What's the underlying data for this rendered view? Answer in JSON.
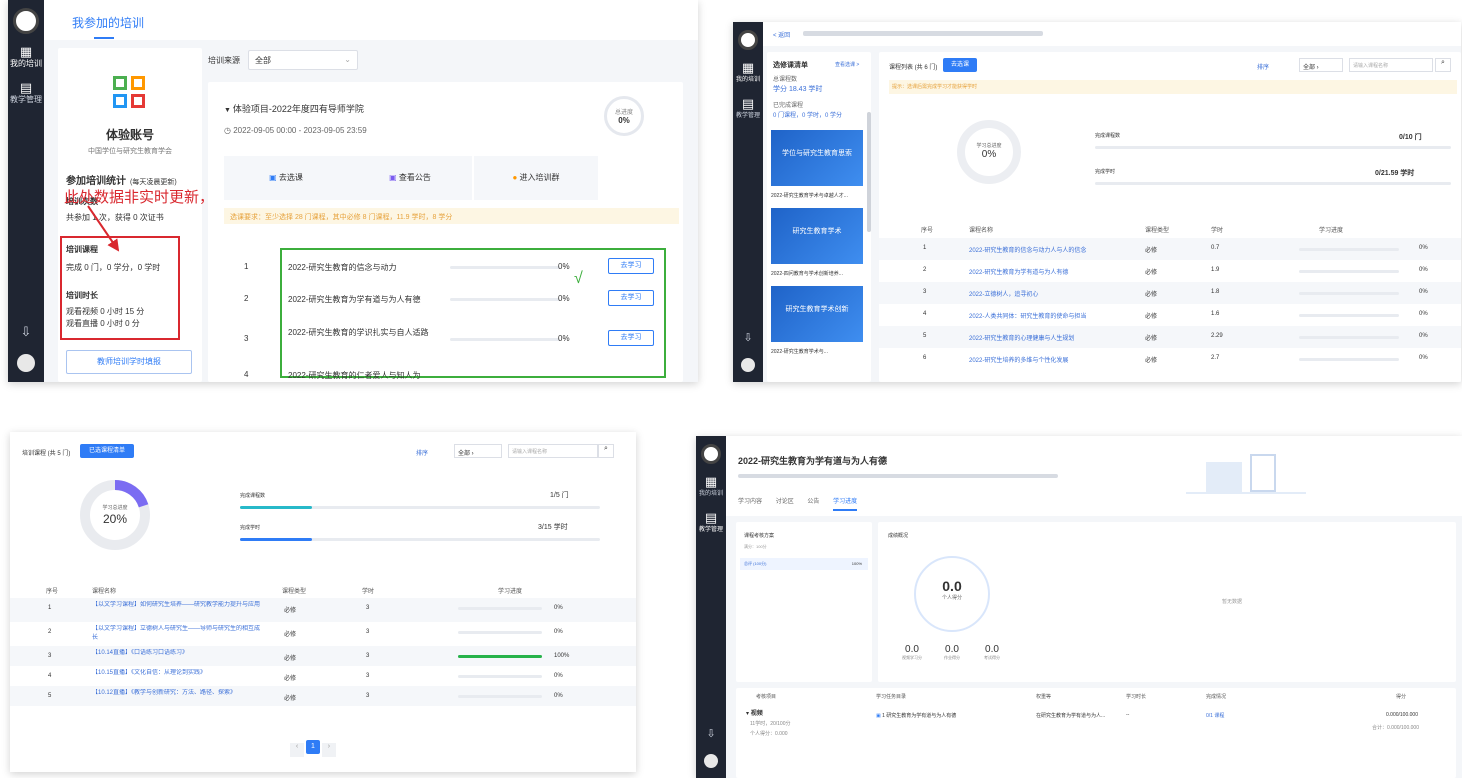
{
  "p1": {
    "nav": [
      {
        "icon": "training-icon",
        "label": "我的培训"
      },
      {
        "icon": "manage-icon",
        "label": "教学管理"
      }
    ],
    "tab": "我参加的培训",
    "account_name": "体验账号",
    "org": "中国学位与研究生教育学会",
    "stats_title": "参加培训统计",
    "stats_note": "(每天凌晨更新)",
    "stats_sub": "培训次数",
    "stats_line": "共参加 1 次，获得 0 次证书",
    "course_title": "培训课程",
    "course_line": "完成 0 门，0 学分，0 学时",
    "time_title": "培训时长",
    "time_line1": "观看视频 0 小时 15 分",
    "time_line2": "观看直播 0 小时 0 分",
    "apply_btn": "教师培训学时填报",
    "filter_label": "培训来源",
    "filter_value": "全部",
    "project_title": "体验项目-2022年度四有导师学院",
    "date_range": "2022-09-05 00:00 - 2023-09-05 23:59",
    "ring_label": "总进度",
    "ring_value": "0%",
    "actions": [
      "去选课",
      "查看公告",
      "进入培训群"
    ],
    "notice": "选课要求：至少选择 28 门课程，其中必修 8 门课程，11.9 学时，8 学分",
    "annotation": "此处数据非实时更新，请以右侧数据为准",
    "check": "√",
    "courses": [
      {
        "no": "1",
        "name": "2022-研究生教育的信念与动力",
        "pct": "0%",
        "btn": "去学习"
      },
      {
        "no": "2",
        "name": "2022-研究生教育为学有道与为人有德",
        "pct": "0%",
        "btn": "去学习"
      },
      {
        "no": "3",
        "name": "2022-研究生教育的学识扎实与自人适路",
        "pct": "0%",
        "btn": "去学习"
      },
      {
        "no": "4",
        "name": "2022-研究生教育的仁者爱人与知人为",
        "pct": "",
        "btn": ""
      }
    ]
  },
  "p2": {
    "nav": [
      {
        "icon": "training-icon",
        "label": "我的培训"
      },
      {
        "icon": "manage-icon",
        "label": "教学管理"
      }
    ],
    "back": "< 返回",
    "left_title": "选修课清单",
    "left_link": "查看选课 >",
    "left_total_label": "总课程数",
    "left_total": "学分 18.43 学时",
    "left_done_label": "已完成课程",
    "left_done": "0 门课程，0 学时，0 学分",
    "videos": [
      "2022-研究生教育学术与卓越人才...",
      "2022-四问教育与学术创新培养...",
      "2022-研究生教育学术与..."
    ],
    "thumb_texts": [
      "学位与研究生教育思索",
      "研究生教育学术",
      "研究生教育学术创新"
    ],
    "tab_label": "课程列表 (共 6 门)",
    "tab_btn": "去选课",
    "notice": "提示：选课后需完成学习才能获得学时",
    "sort": "排序",
    "filter": "全部",
    "search_placeholder": "请输入课程名称",
    "ring_label": "学习总进度",
    "ring_value": "0%",
    "m1_label": "完成课程数",
    "m1_value": "0/10 门",
    "m2_label": "完成学时",
    "m2_value": "0/21.59 学时",
    "headers": [
      "序号",
      "课程名称",
      "课程类型",
      "学时",
      "学习进度"
    ],
    "rows": [
      {
        "no": "1",
        "name": "2022-研究生教育的信念与动力人与人的信念",
        "type": "必修",
        "hours": "0.7",
        "pct": "0%"
      },
      {
        "no": "2",
        "name": "2022-研究生教育为学有道与为人有德",
        "type": "必修",
        "hours": "1.9",
        "pct": "0%"
      },
      {
        "no": "3",
        "name": "2022-立德树人，追寻初心",
        "type": "必修",
        "hours": "1.8",
        "pct": "0%"
      },
      {
        "no": "4",
        "name": "2022-人类共同体：研究生教育的使命与担当",
        "type": "必修",
        "hours": "1.6",
        "pct": "0%"
      },
      {
        "no": "5",
        "name": "2022-研究生教育的心理健康与人生规划",
        "type": "必修",
        "hours": "2.29",
        "pct": "0%"
      },
      {
        "no": "6",
        "name": "2022-研究生培养的多维与个性化发展",
        "type": "必修",
        "hours": "2.7",
        "pct": "0%"
      }
    ]
  },
  "p3": {
    "tab_label": "培训课程 (共 5 门)",
    "tab_btn": "已选课程清单",
    "sort": "排序",
    "filter": "全部",
    "search_placeholder": "请输入课程名称",
    "ring_label": "学习总进度",
    "ring_value": "20%",
    "ring_pct": 20,
    "m1_label": "完成课程数",
    "m1_value": "1/5 门",
    "m1_pct": 20,
    "m2_label": "完成学时",
    "m2_value": "3/15 学时",
    "m2_pct": 20,
    "headers": [
      "序号",
      "课程名称",
      "课程类型",
      "学时",
      "学习进度"
    ],
    "rows": [
      {
        "no": "1",
        "name": "【以文学习课程】如何研究生培养——研究教学能力提升与应用",
        "type": "必修",
        "hours": "3",
        "pct": "0%",
        "val": 0
      },
      {
        "no": "2",
        "name": "【以文学习课程】立德树人与研究生——导师与研究生的相互成长",
        "type": "必修",
        "hours": "3",
        "pct": "0%",
        "val": 0
      },
      {
        "no": "3",
        "name": "【10.14直播】《口语练习口语练习》",
        "type": "必修",
        "hours": "3",
        "pct": "100%",
        "val": 100
      },
      {
        "no": "4",
        "name": "【10.15直播】《文化自信：从理论到实践》",
        "type": "必修",
        "hours": "3",
        "pct": "0%",
        "val": 0
      },
      {
        "no": "5",
        "name": "【10.12直播】《教学与创新研究：方法、路径、探索》",
        "type": "必修",
        "hours": "3",
        "pct": "0%",
        "val": 0
      }
    ],
    "page": "1"
  },
  "p4": {
    "nav": [
      {
        "icon": "training-icon",
        "label": "我的培训"
      },
      {
        "icon": "manage-icon",
        "label": "教学管理"
      }
    ],
    "title": "2022-研究生教育为学有道与为人有德",
    "tabs": [
      "学习内容",
      "讨论区",
      "公告",
      "学习进度"
    ],
    "plan_title": "课程考核方案",
    "plan_sub": "满分：100分",
    "plan_row": "总评 (100分)",
    "plan_row_value": "100%",
    "score_title": "成绩概况",
    "score_value": "0.0",
    "score_label": "个人得分",
    "subs": [
      {
        "v": "0.0",
        "l": "视频学习分"
      },
      {
        "v": "0.0",
        "l": "作业得分"
      },
      {
        "v": "0.0",
        "l": "考试得分"
      }
    ],
    "empty": "暂无数据",
    "headers": [
      "考核项目",
      "学习任务目录",
      "权重等",
      "学习时长",
      "完成情况",
      "得分"
    ],
    "item": "视频",
    "item_meta1": "11学时，20/100分",
    "item_meta2": "个人得分：0.000",
    "task": "1 研究生教育为学有道与为人有德",
    "task_desc": "在研究生教育为学有道与为人...",
    "dash": "--",
    "done": "0/1 课程",
    "score": "0.000/100.000",
    "total": "合计：0.000/100.000"
  }
}
